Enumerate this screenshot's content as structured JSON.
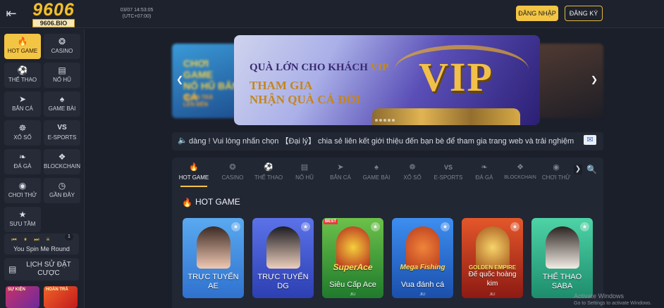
{
  "header": {
    "logo_text": "9606",
    "logo_sub": "9606.BIO",
    "clock_date": "03/07 14:53:05",
    "clock_tz": "(UTC+07:00)",
    "login_label": "ĐĂNG NHẬP",
    "register_label": "ĐĂNG KÝ"
  },
  "sidebar": {
    "items": [
      {
        "label": "HOT GAME",
        "icon": "fire-icon"
      },
      {
        "label": "CASINO",
        "icon": "dragon-icon"
      },
      {
        "label": "THỂ THAO",
        "icon": "soccer-ball-icon"
      },
      {
        "label": "NỔ HŨ",
        "icon": "slot-777-icon"
      },
      {
        "label": "BẮN CÁ",
        "icon": "fish-icon"
      },
      {
        "label": "GAME BÀI",
        "icon": "cards-icon"
      },
      {
        "label": "XỔ SỐ",
        "icon": "lottery-icon"
      },
      {
        "label": "E-SPORTS",
        "icon": "vs-icon"
      },
      {
        "label": "ĐÁ GÀ",
        "icon": "rooster-icon"
      },
      {
        "label": "BLOCKCHAIN",
        "icon": "blockchain-icon"
      },
      {
        "label": "CHƠI THỬ",
        "icon": "gamepad-icon"
      },
      {
        "label": "GẦN ĐÂY",
        "icon": "clock-icon"
      },
      {
        "label": "SƯU TẦM",
        "icon": "star-icon"
      }
    ],
    "spin": {
      "title": "You Spin Me Round",
      "badge": "1"
    },
    "history_label": "LỊCH SỬ ĐẶT CƯỢC",
    "promo1_label": "SỰ KIỆN",
    "promo2_label": "HOÀN TRẢ"
  },
  "banner": {
    "line1": "QUÀ LỚN CHO KHÁCH",
    "line1_vip": "VIP",
    "line2": "THAM GIA",
    "line3": "NHẬN QUÀ CẢ ĐỜI",
    "vip_text": "VIP",
    "left_line1": "CHƠI GAME",
    "left_line2": "NỔ HŨ BẮN CÁ",
    "left_line3": "HOÀN TRẢ",
    "left_line4": "LÊN ĐẾN"
  },
  "marquee": {
    "text": "dàng ! Vui lòng nhấn chọn 【Đại lý】 chia sẻ liên kết giới thiệu đến bạn bè để tham gia trang web và trải nghiệm"
  },
  "tabs": [
    {
      "label": "HOT GAME",
      "icon": "fire-icon",
      "active": true
    },
    {
      "label": "CASINO",
      "icon": "dragon-icon"
    },
    {
      "label": "THỂ THAO",
      "icon": "soccer-ball-icon"
    },
    {
      "label": "NỔ HŨ",
      "icon": "slot-777-icon"
    },
    {
      "label": "BẮN CÁ",
      "icon": "fish-icon"
    },
    {
      "label": "GAME BÀI",
      "icon": "cards-icon"
    },
    {
      "label": "XỔ SỐ",
      "icon": "lottery-icon"
    },
    {
      "label": "E-SPORTS",
      "icon": "vs-icon"
    },
    {
      "label": "ĐÁ GÀ",
      "icon": "rooster-icon"
    },
    {
      "label": "BLOCKCHAIN",
      "icon": "blockchain-icon"
    },
    {
      "label": "CHƠI THỬ",
      "icon": "gamepad-icon"
    }
  ],
  "section": {
    "title": "HOT GAME"
  },
  "games": [
    {
      "title": "TRỰC TUYẾN AE",
      "bg": "#3f8be0"
    },
    {
      "title": "TRỰC TUYẾN DG",
      "bg": "#3d56c9"
    },
    {
      "title": "Siêu Cấp Ace",
      "badge": "BEST",
      "logo": "SuperAce",
      "vendor": "JILI",
      "bg": "#2f9b3a"
    },
    {
      "title": "Vua đánh cá",
      "logo": "Mega Fishing",
      "vendor": "JILI",
      "bg": "#2b6fd1"
    },
    {
      "title": "Đế quốc hoàng kim",
      "logo": "GOLDEN EMPIRE",
      "vendor": "JILI",
      "bg": "#b1301e"
    },
    {
      "title": "THỂ THAO SABA",
      "bg": "#2fb28a"
    }
  ],
  "watermark": {
    "line1": "Activate Windows",
    "line2": "Go to Settings to activate Windows."
  }
}
